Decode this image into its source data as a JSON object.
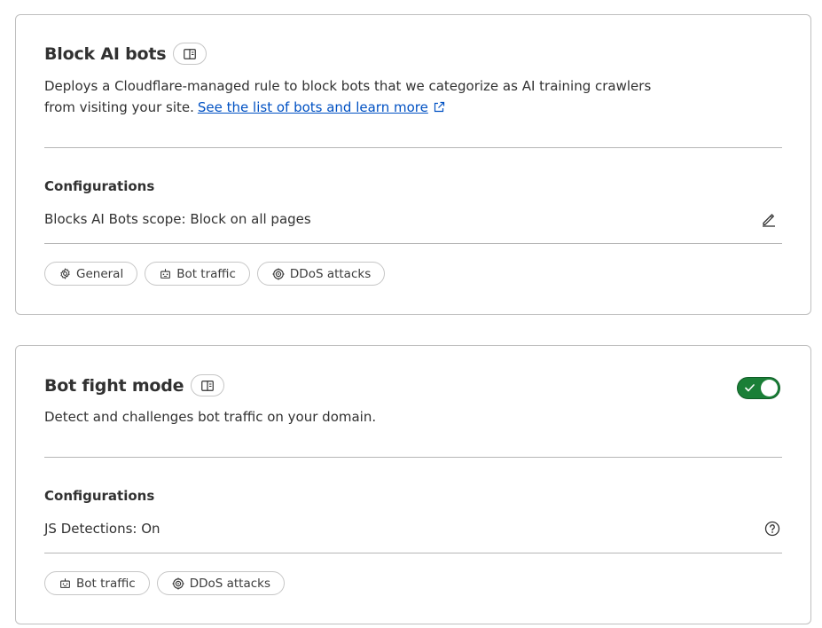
{
  "block_ai_bots": {
    "title": "Block AI bots",
    "description_line1": "Deploys a Cloudflare-managed rule to block bots that we categorize as AI training crawlers",
    "description_line2": "from visiting your site.",
    "link_text": "See the list of bots and learn more",
    "config_heading": "Configurations",
    "config_value": "Blocks AI Bots scope: Block on all pages",
    "tags": [
      "General",
      "Bot traffic",
      "DDoS attacks"
    ]
  },
  "bot_fight_mode": {
    "title": "Bot fight mode",
    "description": "Detect and challenges bot traffic on your domain.",
    "toggle_on": true,
    "config_heading": "Configurations",
    "config_value": "JS Detections: On",
    "tags": [
      "Bot traffic",
      "DDoS attacks"
    ]
  },
  "icons": {
    "book": "book-open-icon",
    "external_link": "external-link-icon",
    "edit": "pencil-icon",
    "help": "question-circle-icon",
    "gear": "gear-icon",
    "robot": "robot-icon",
    "target": "crosshair-icon",
    "check": "check-icon"
  },
  "colors": {
    "link": "#0051c3",
    "toggle_on": "#1a7f37",
    "border": "#bfbfbf"
  }
}
